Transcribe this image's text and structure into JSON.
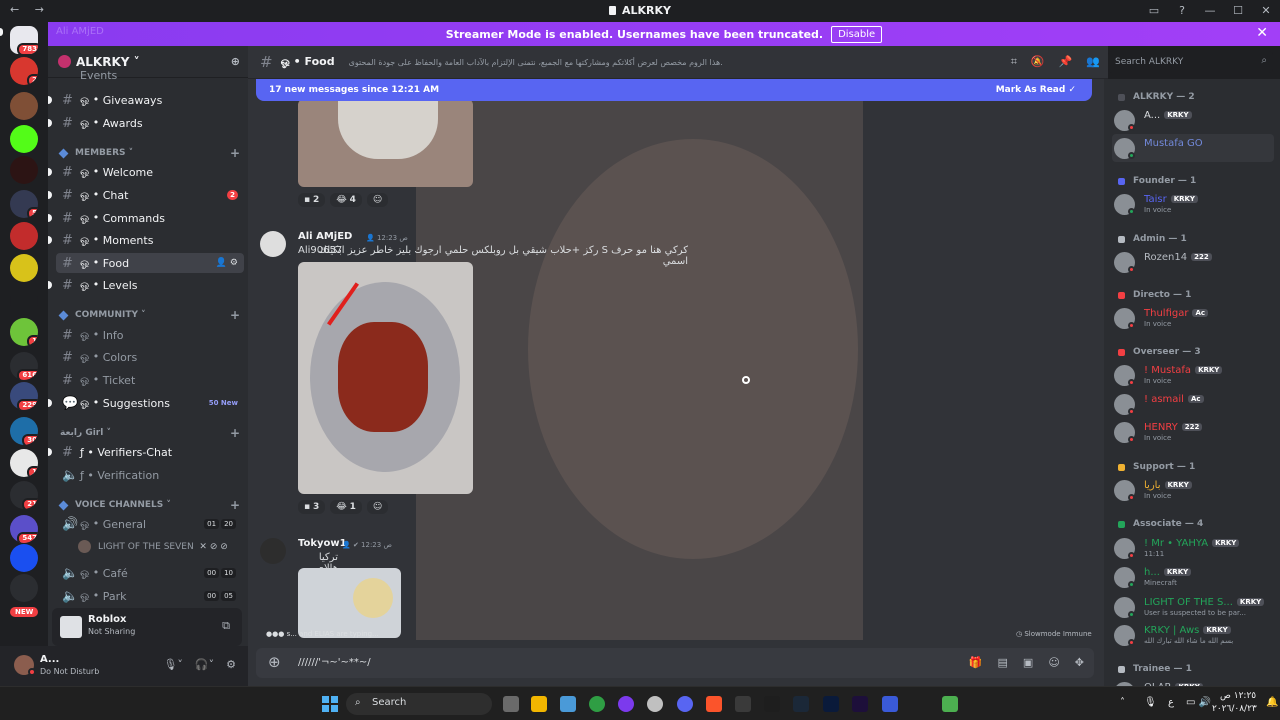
{
  "titlebar": {
    "title": "ALKRKY",
    "nav": "← →"
  },
  "banner": {
    "ghost_text": "Ali AMjED",
    "message": "Streamer Mode is enabled. Usernames have been truncated.",
    "disable": "Disable",
    "close": "✕"
  },
  "servers": [
    {
      "badge": "783",
      "color": "#e8e8ee"
    },
    {
      "badge": "2",
      "color": "#d8372f"
    },
    {
      "badge": "",
      "color": "#7f4f36"
    },
    {
      "badge": "",
      "color": "#53fc18"
    },
    {
      "badge": "",
      "color": "#2c1414"
    },
    {
      "badge": "5",
      "color": "#343a52"
    },
    {
      "badge": "",
      "color": "#c22c2c"
    },
    {
      "badge": "",
      "color": "#d8c21a"
    },
    {
      "badge": "",
      "color": "#1e1f22"
    },
    {
      "badge": "1",
      "color": "#6ec43a"
    },
    {
      "badge": "616",
      "color": "#2b2d31"
    },
    {
      "badge": "229",
      "color": "#394a7c"
    },
    {
      "badge": "30",
      "color": "#1e6ea8"
    },
    {
      "badge": "1",
      "color": "#e8e8e8"
    },
    {
      "badge": "21",
      "color": "#2b2d31"
    },
    {
      "badge": "547",
      "color": "#5b4fc9"
    },
    {
      "badge": "",
      "color": "#1a4ff0"
    },
    {
      "badge": "",
      "color": "#2b2d31"
    }
  ],
  "server_new": "NEW",
  "guild": {
    "name": "ALKRKY ˅",
    "add_user_icon": "person-plus"
  },
  "channels": {
    "events": "Events",
    "giveaways": "Giveaways",
    "awards": "Awards",
    "members_cat": "MEMBERS",
    "welcome": "Welcome",
    "chat": "Chat",
    "chat_badge": "2",
    "commands": "Commands",
    "moments": "Moments",
    "food": "Food",
    "levels": "Levels",
    "community_cat": "COMMUNITY",
    "info": "Info",
    "colors": "Colors",
    "ticket": "Ticket",
    "suggestions": "Suggestions",
    "suggestions_new": "50 New",
    "girl_cat": "رابعة Girl",
    "verifiers": "Verifiers-Chat",
    "verification": "Verification",
    "voice_cat": "VOICE CHANNELS",
    "general": "General",
    "general_counts": [
      "01",
      "20"
    ],
    "voice_user": "LIGHT OF THE SEVEN",
    "cafe": "Café",
    "cafe_counts": [
      "00",
      "10"
    ],
    "park": "Park",
    "park_counts": [
      "00",
      "05"
    ],
    "prefix": "ஓ •"
  },
  "activity": {
    "title": "Roblox",
    "status": "Not Sharing"
  },
  "user": {
    "name": "A...",
    "status": "Do Not Disturb"
  },
  "header": {
    "channel": "Food",
    "prefix": "ஓ •",
    "topic": "هذا الروم مخصص لعرض أكلاتكم ومشاركتها مع الجميع، نتمنى الإلتزام بالآداب العامة والحفاظ على جودة المحتوى."
  },
  "search": {
    "placeholder": "Search ALKRKY"
  },
  "newbar": {
    "text": "17 new messages since 12:21 AM",
    "mark": "Mark As Read"
  },
  "messages": [
    {
      "reactions": [
        "2",
        "4"
      ]
    },
    {
      "author": "Ali AMjED",
      "time": "12:23 ص",
      "line1": "كركي هنا مو حرف S ركز +حلاب شيقي بل روبلكس حلمي ارجوك بليز خاطر عزيز ابكيلك اسمي",
      "line2": "Ali90657",
      "reactions": [
        "3",
        "1"
      ]
    },
    {
      "author": "Tokyow1",
      "time": "12:23 ص",
      "line1": "تركيا هالاي"
    }
  ],
  "typing": {
    "text": "s... and ELIAS are typing..."
  },
  "slowmode": "Slowmode Immune",
  "composer": {
    "text": "//////'¬~'~**~/"
  },
  "members": {
    "groups": [
      {
        "title": "ALKRKY — 2",
        "color": "#4e5058"
      },
      {
        "title": "Founder — 1",
        "color": "#5865f2"
      },
      {
        "title": "Admin — 1",
        "color": "#b5bac1"
      },
      {
        "title": "Directo — 1",
        "color": "#f23f43"
      },
      {
        "title": "Overseer — 3",
        "color": "#f23f43"
      },
      {
        "title": "Support — 1",
        "color": "#f0b232"
      },
      {
        "title": "Associate — 4",
        "color": "#23a55a"
      },
      {
        "title": "Trainee — 1",
        "color": "#b5bac1"
      }
    ],
    "list": [
      {
        "name": "A...",
        "tag": "KRKY",
        "sub": "",
        "color": "#dbdee1"
      },
      {
        "name": "Mustafa GO",
        "tag": "",
        "sub": "",
        "color": "#7289da"
      },
      {
        "name": "Taisr",
        "tag": "KRKY",
        "sub": "In voice",
        "color": "#5865f2"
      },
      {
        "name": "Rozen14",
        "tag": "222",
        "sub": "",
        "color": "#b5bac1"
      },
      {
        "name": "Thulfigar",
        "tag": "Ac",
        "sub": "In voice",
        "color": "#f23f43"
      },
      {
        "name": "! Mustafa",
        "tag": "KRKY",
        "sub": "In voice",
        "color": "#f23f43"
      },
      {
        "name": "! asmail",
        "tag": "Ac",
        "sub": "",
        "color": "#f23f43"
      },
      {
        "name": "HENRY",
        "tag": "222",
        "sub": "In voice",
        "color": "#f23f43"
      },
      {
        "name": "باريا",
        "tag": "KRKY",
        "sub": "In voice",
        "color": "#f0b232"
      },
      {
        "name": "! Mr • YAHYA",
        "tag": "KRKY",
        "sub": "11:11",
        "color": "#23a55a"
      },
      {
        "name": "h...",
        "tag": "KRKY",
        "sub": "Minecraft",
        "color": "#23a55a"
      },
      {
        "name": "LIGHT OF THE S...",
        "tag": "KRKY",
        "sub": "User is suspected to be par...",
        "color": "#23a55a"
      },
      {
        "name": "KRKY | Aws",
        "tag": "KRKY",
        "sub": "بسم الله ما شاء الله تبارك الله",
        "color": "#23a55a"
      },
      {
        "name": "OLAR",
        "tag": "KRKY",
        "sub": "",
        "color": "#b5bac1"
      }
    ]
  },
  "taskbar": {
    "search": "Search",
    "time": "١٢:٢٥ ص",
    "date": "٢٠٢٦/٠٨/٢٣",
    "lang": "ع"
  }
}
